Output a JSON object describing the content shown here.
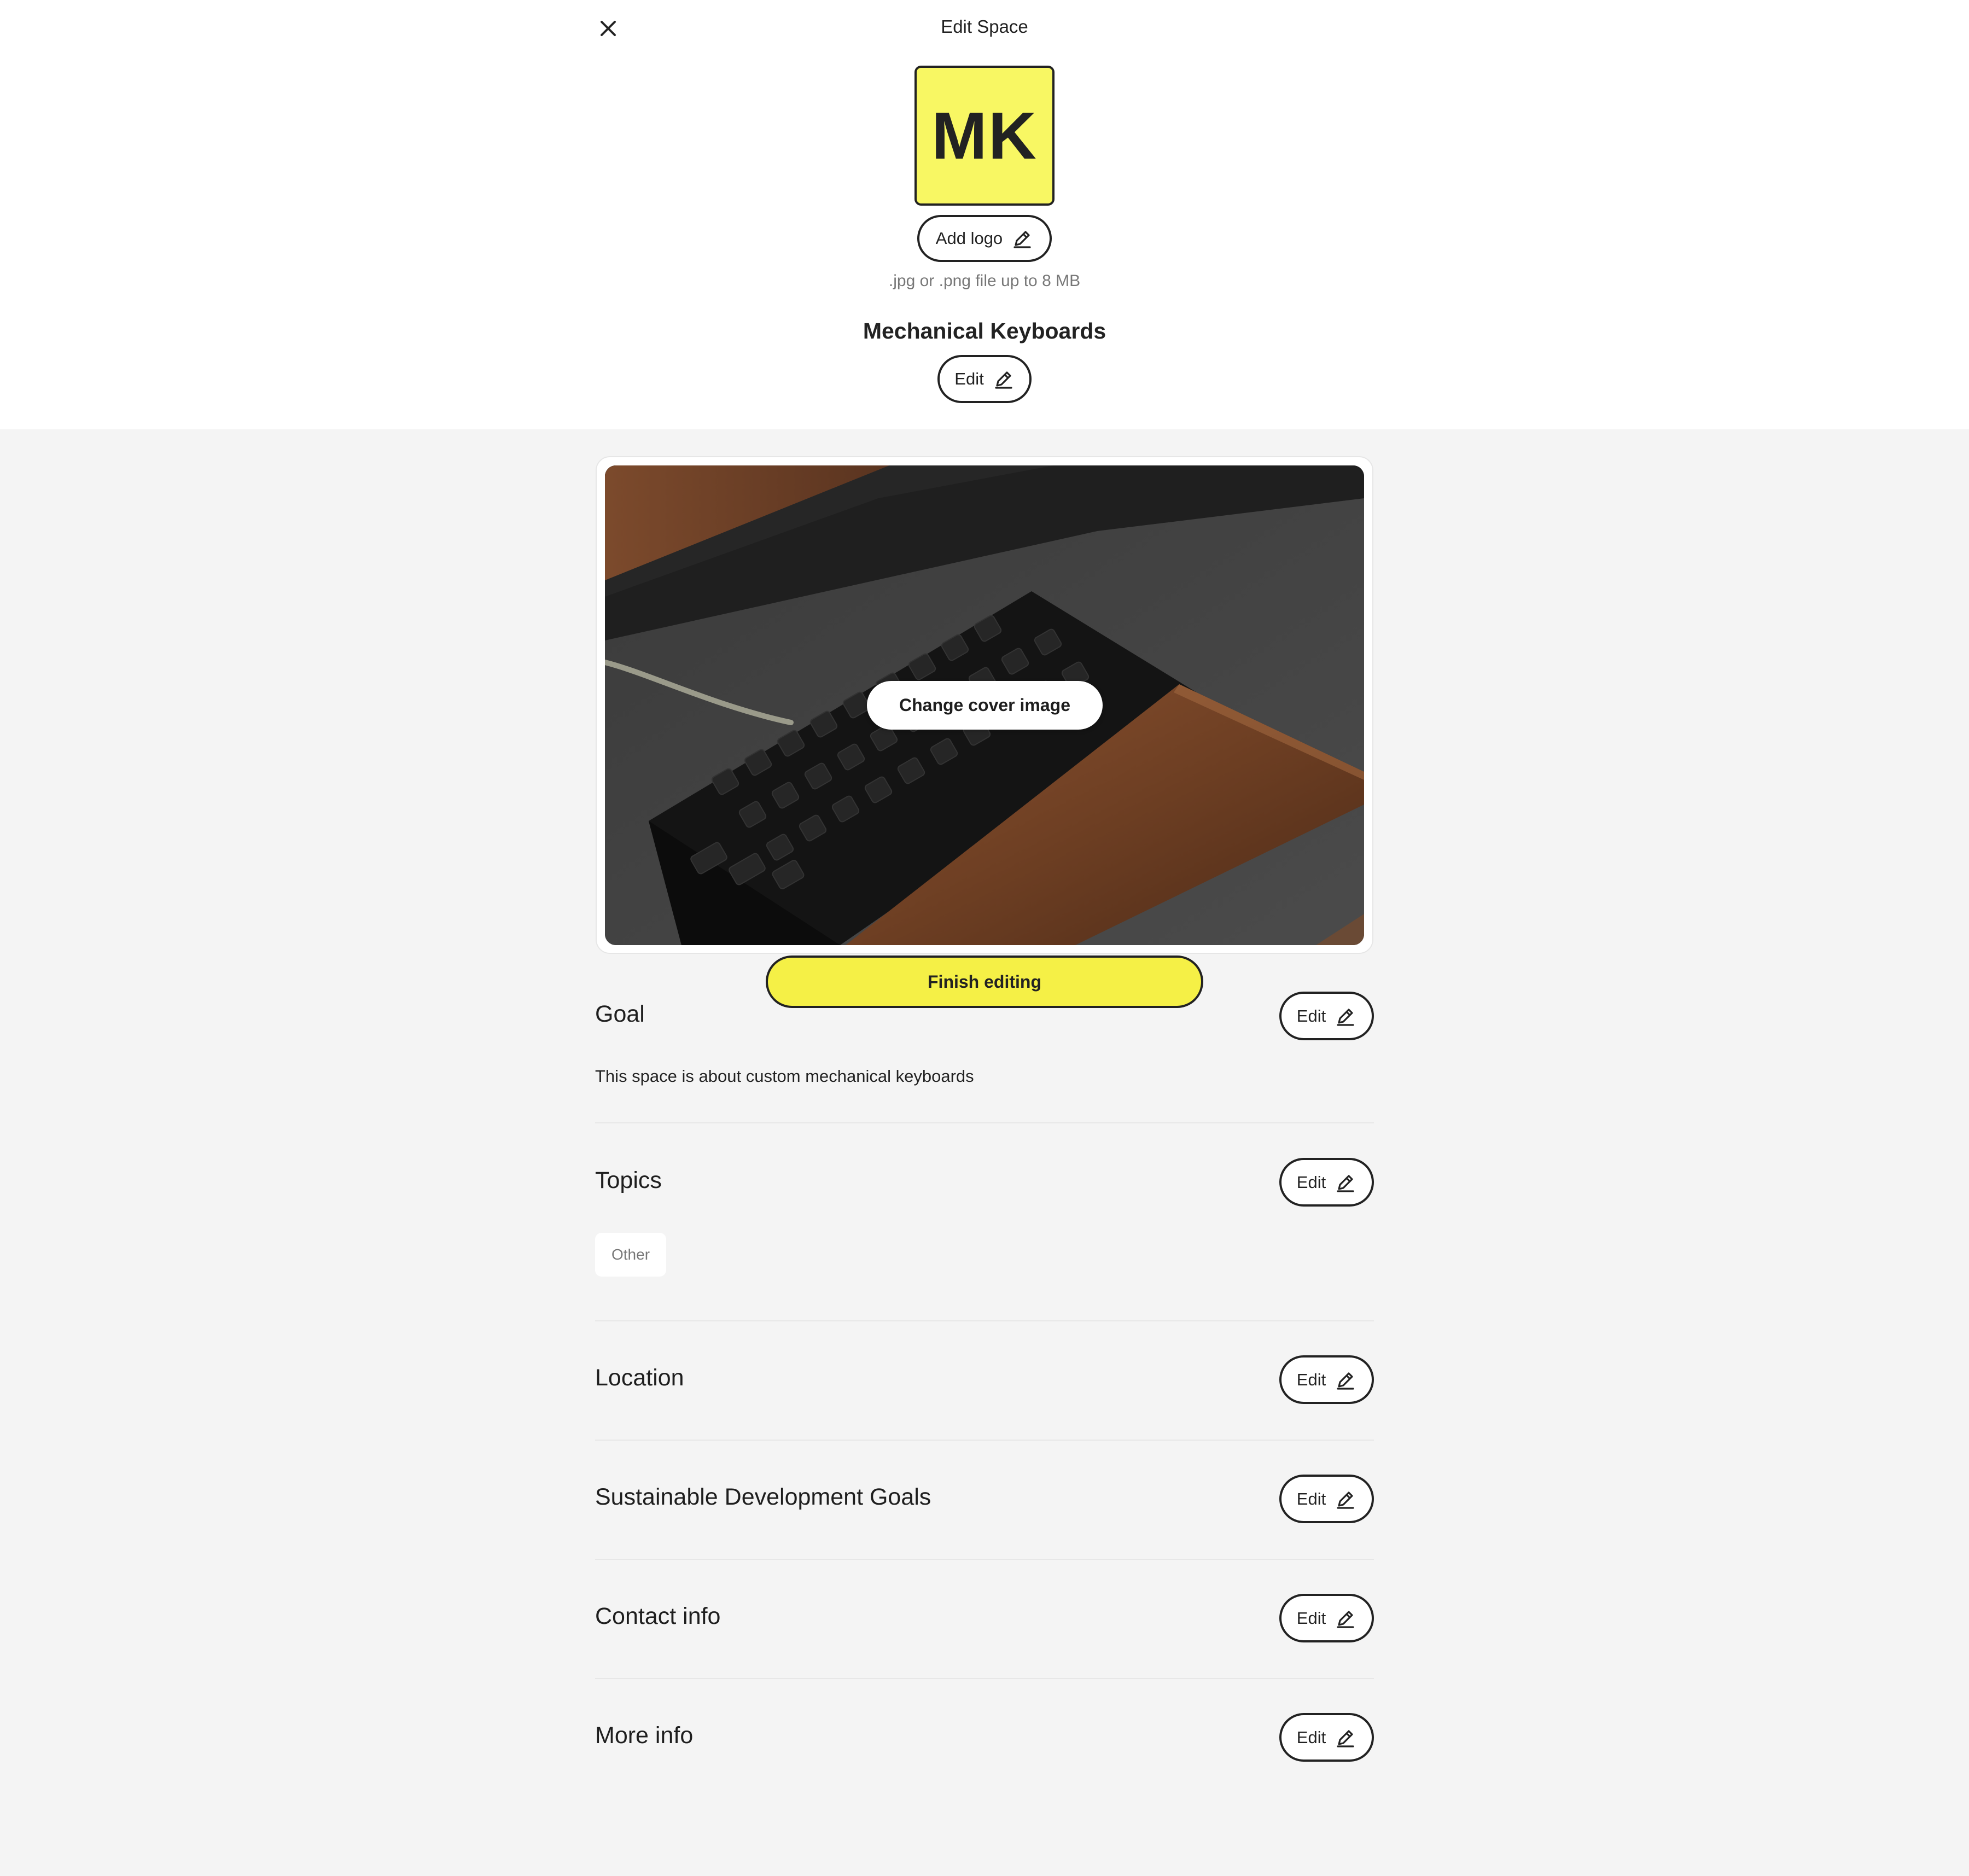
{
  "header": {
    "title": "Edit Space",
    "close_icon": "close-icon"
  },
  "logo": {
    "initials": "MK",
    "background_color": "#f8f763",
    "add_logo_label": "Add logo",
    "hint": ".jpg or .png file up to 8 MB"
  },
  "space": {
    "name": "Mechanical Keyboards",
    "edit_label": "Edit"
  },
  "cover": {
    "change_label": "Change cover image"
  },
  "finish": {
    "label": "Finish editing",
    "color": "#f5f046"
  },
  "sections": {
    "goal": {
      "title": "Goal",
      "edit_label": "Edit",
      "text": "This space is about custom mechanical keyboards"
    },
    "topics": {
      "title": "Topics",
      "edit_label": "Edit",
      "chips": [
        "Other"
      ]
    },
    "location": {
      "title": "Location",
      "edit_label": "Edit"
    },
    "sdg": {
      "title": "Sustainable Development Goals",
      "edit_label": "Edit"
    },
    "contact": {
      "title": "Contact info",
      "edit_label": "Edit"
    },
    "more": {
      "title": "More info",
      "edit_label": "Edit"
    }
  }
}
